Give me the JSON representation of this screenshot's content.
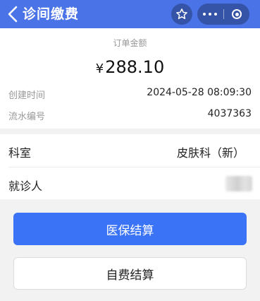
{
  "header": {
    "title": "诊间缴费"
  },
  "order": {
    "label": "订单金额",
    "currency": "¥",
    "amount": "288.10",
    "created_label": "创建时间",
    "created_value": "2024-05-28 08:09:30",
    "serial_label": "流水编号",
    "serial_value": "4037363"
  },
  "info": {
    "department_label": "科室",
    "department_value": "皮肤科（新）",
    "patient_label": "就诊人"
  },
  "actions": {
    "insurance_label": "医保结算",
    "selfpay_label": "自费结算"
  },
  "colors": {
    "header_bg": "#4a73e8",
    "primary_button": "#3a73f6"
  },
  "icons": {
    "back": "chevron-left-icon",
    "star": "star-icon",
    "more": "more-dots-icon",
    "close": "target-close-icon"
  }
}
